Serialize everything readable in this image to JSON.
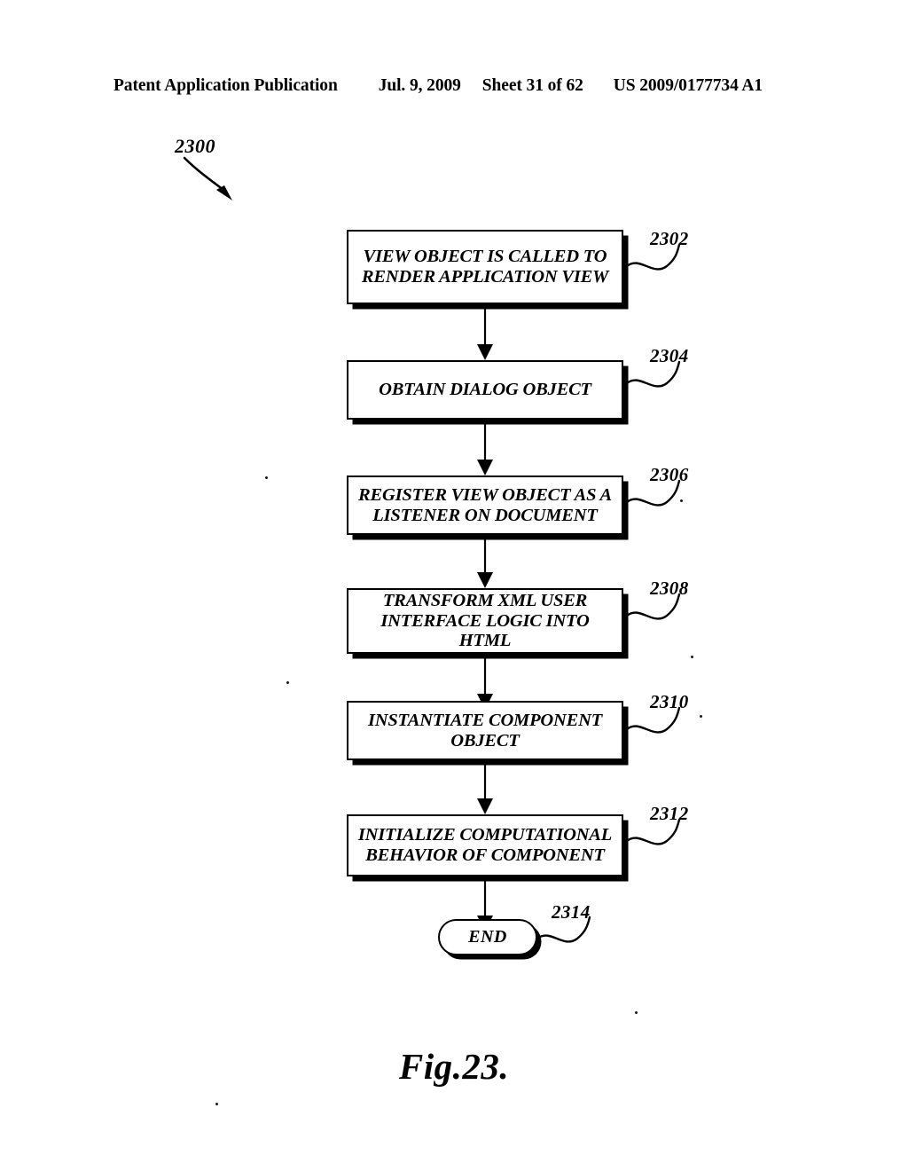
{
  "header": {
    "publication": "Patent Application Publication",
    "date": "Jul. 9, 2009",
    "sheet": "Sheet 31 of 62",
    "patent_number": "US 2009/0177734 A1"
  },
  "figure": {
    "caption": "Fig.23.",
    "flow_reference": "2300"
  },
  "flowchart": {
    "type": "process-flow",
    "orientation": "vertical",
    "nodes": [
      {
        "ref": "2302",
        "shape": "rectangle",
        "text": "VIEW OBJECT IS CALLED TO\nRENDER APPLICATION VIEW"
      },
      {
        "ref": "2304",
        "shape": "rectangle",
        "text": "OBTAIN DIALOG OBJECT"
      },
      {
        "ref": "2306",
        "shape": "rectangle",
        "text": "REGISTER VIEW OBJECT AS A\nLISTENER ON DOCUMENT"
      },
      {
        "ref": "2308",
        "shape": "rectangle",
        "text": "TRANSFORM XML USER\nINTERFACE LOGIC INTO\nHTML"
      },
      {
        "ref": "2310",
        "shape": "rectangle",
        "text": "INSTANTIATE COMPONENT\nOBJECT"
      },
      {
        "ref": "2312",
        "shape": "rectangle",
        "text": "INITIALIZE COMPUTATIONAL\nBEHAVIOR OF COMPONENT"
      },
      {
        "ref": "2314",
        "shape": "terminal",
        "text": "END"
      }
    ]
  },
  "colors": {
    "ink": "#000000",
    "page": "#ffffff"
  }
}
